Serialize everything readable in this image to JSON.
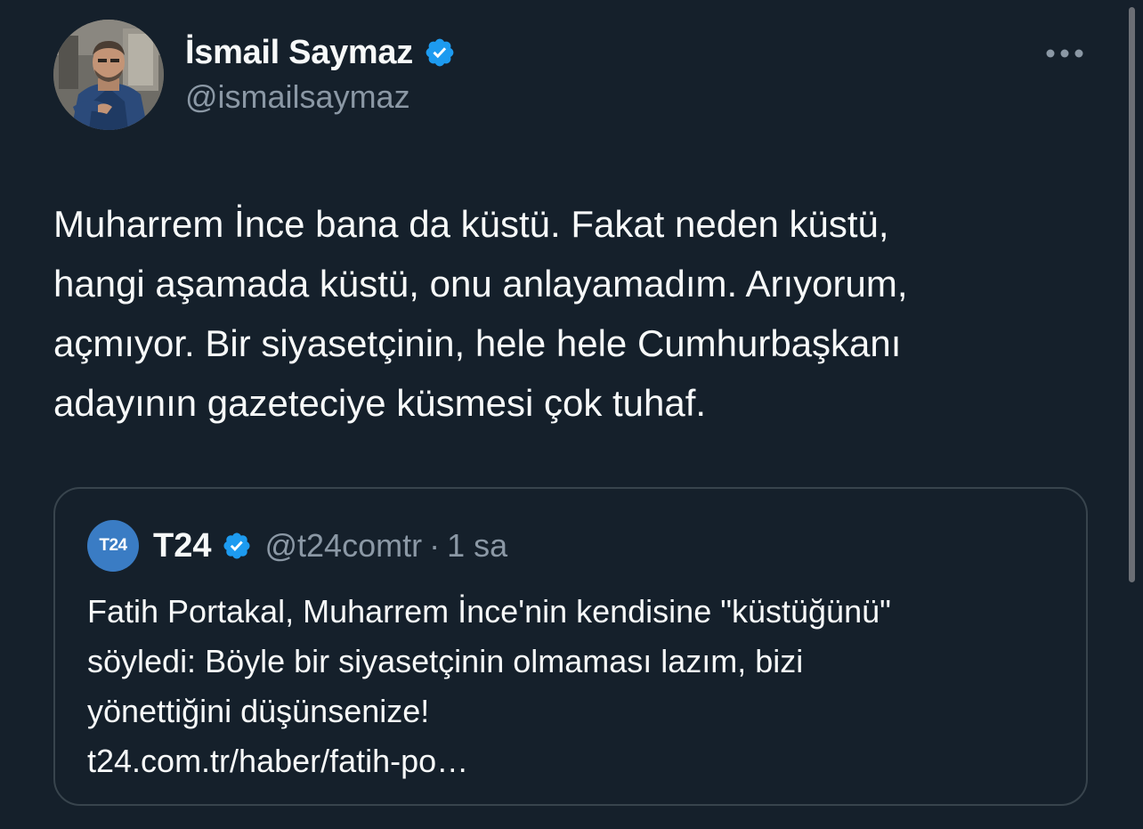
{
  "tweet": {
    "author": {
      "display_name": "İsmail Saymaz",
      "handle": "@ismailsaymaz",
      "verified": true,
      "verified_color": "#1d9bf0"
    },
    "text": "Muharrem İnce bana da küstü. Fakat neden küstü,\nhangi aşamada küstü, onu anlayamadım. Arıyorum,\naçmıyor. Bir siyasetçinin, hele hele Cumhurbaşkanı\nadayının gazeteciye küsmesi çok tuhaf.",
    "more_icon": "more-horizontal-icon"
  },
  "quoted_tweet": {
    "avatar_label": "T24",
    "display_name": "T24",
    "handle": "@t24comtr",
    "separator": "·",
    "time": "1 sa",
    "verified": true,
    "text": "Fatih Portakal, Muharrem İnce'nin kendisine \"küstüğünü\"\nsöyledi: Böyle bir siyasetçinin olmaması lazım, bizi\nyönettiğini düşünsenize!",
    "link": "t24.com.tr/haber/fatih-po…"
  },
  "theme": {
    "background": "#15202b",
    "text": "#f7f9f9",
    "secondary_text": "#8b98a5",
    "border": "#38444d",
    "avatar_blue": "#3a7cc4"
  }
}
